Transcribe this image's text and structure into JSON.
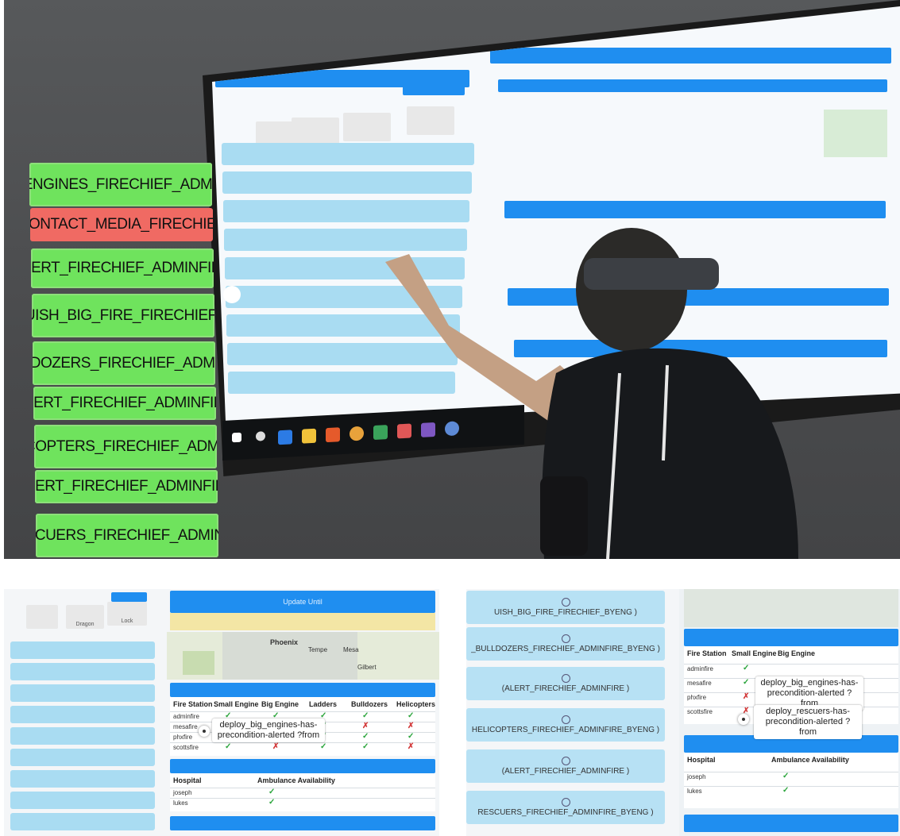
{
  "holo_actions": [
    {
      "label": "DEPLOY_BIG_ENGINES_FIRECHIEF_ADMINFIRE_BYENG",
      "status": "ok"
    },
    {
      "label": "CONTACT_MEDIA_FIRECHIEF",
      "status": "bad"
    },
    {
      "label": "ALERT_FIRECHIEF_ADMINFIRE",
      "status": "ok"
    },
    {
      "label": "EXTINGUISH_BIG_FIRE_FIRECHIEF_BYENG",
      "status": "ok"
    },
    {
      "label": "DEPLOY_BULLDOZERS_FIRECHIEF_ADMINFIRE_BYENG",
      "status": "ok"
    },
    {
      "label": "ALERT_FIRECHIEF_ADMINFIRE",
      "status": "ok"
    },
    {
      "label": "DEPLOY_HELICOPTERS_FIRECHIEF_ADMINFIRE_BYENG",
      "status": "ok"
    },
    {
      "label": "ALERT_FIRECHIEF_ADMINFIRE",
      "status": "ok"
    },
    {
      "label": "DEPLOY_RESCUERS_FIRECHIEF_ADMINFIRE_BYENG",
      "status": "ok"
    }
  ],
  "colors": {
    "ok": "#6fe35d",
    "bad": "#f06a63",
    "accent": "#1f8ef0",
    "plan_row": "#a9dcf2"
  },
  "bottom_left": {
    "update_button": "Update Until",
    "tile_labels": [
      "Dragon",
      "Lock"
    ],
    "map_labels": [
      "Phoenix",
      "Tempe",
      "Mesa",
      "Gilbert"
    ],
    "fire_section": {
      "headers": [
        "Fire Station",
        "Small Engine",
        "Big Engine",
        "Ladders",
        "Bulldozers",
        "Helicopters"
      ],
      "rows": [
        {
          "name": "adminfire",
          "cells": [
            "✓",
            "✓",
            "✓",
            "✓",
            "✓"
          ]
        },
        {
          "name": "mesafire",
          "cells": [
            "✓",
            "✓",
            "✓",
            "✗",
            "✗"
          ]
        },
        {
          "name": "phxfire",
          "cells": [
            "✓",
            "✓",
            "✓",
            "✓",
            "✓"
          ]
        },
        {
          "name": "scottsfire",
          "cells": [
            "✓",
            "✗",
            "✓",
            "✓",
            "✗"
          ]
        }
      ]
    },
    "tooltip": "deploy_big_engines-has-precondition-alerted ?from",
    "hospital_section": {
      "headers": [
        "Hospital",
        "Ambulance Availability"
      ],
      "rows": [
        {
          "name": "joseph",
          "cells": [
            "✓"
          ]
        },
        {
          "name": "lukes",
          "cells": [
            "✓"
          ]
        }
      ]
    }
  },
  "bottom_right": {
    "plan_cards": [
      "UISH_BIG_FIRE_FIRECHIEF_BYENG )",
      "_BULLDOZERS_FIRECHIEF_ADMINFIRE_BYENG )",
      "(ALERT_FIRECHIEF_ADMINFIRE )",
      "HELICOPTERS_FIRECHIEF_ADMINFIRE_BYENG )",
      "(ALERT_FIRECHIEF_ADMINFIRE )",
      "RESCUERS_FIRECHIEF_ADMINFIRE_BYENG )"
    ],
    "fire_headers": [
      "Fire Station",
      "Small Engine",
      "Big Engine"
    ],
    "fire_rows": [
      {
        "name": "adminfire",
        "cells": [
          "✓"
        ]
      },
      {
        "name": "mesafire",
        "cells": [
          "✓"
        ]
      },
      {
        "name": "phxfire",
        "cells": [
          "✗"
        ]
      },
      {
        "name": "scottsfire",
        "cells": [
          "✗"
        ]
      }
    ],
    "tooltip_1": "deploy_big_engines-has-precondition-alerted ?from",
    "tooltip_2": "deploy_rescuers-has-precondition-alerted ?from",
    "hospital_headers": [
      "Hospital",
      "Ambulance Availability"
    ],
    "hospital_rows": [
      {
        "name": "joseph",
        "cells": [
          "✓"
        ]
      },
      {
        "name": "lukes",
        "cells": [
          "✓"
        ]
      }
    ]
  }
}
